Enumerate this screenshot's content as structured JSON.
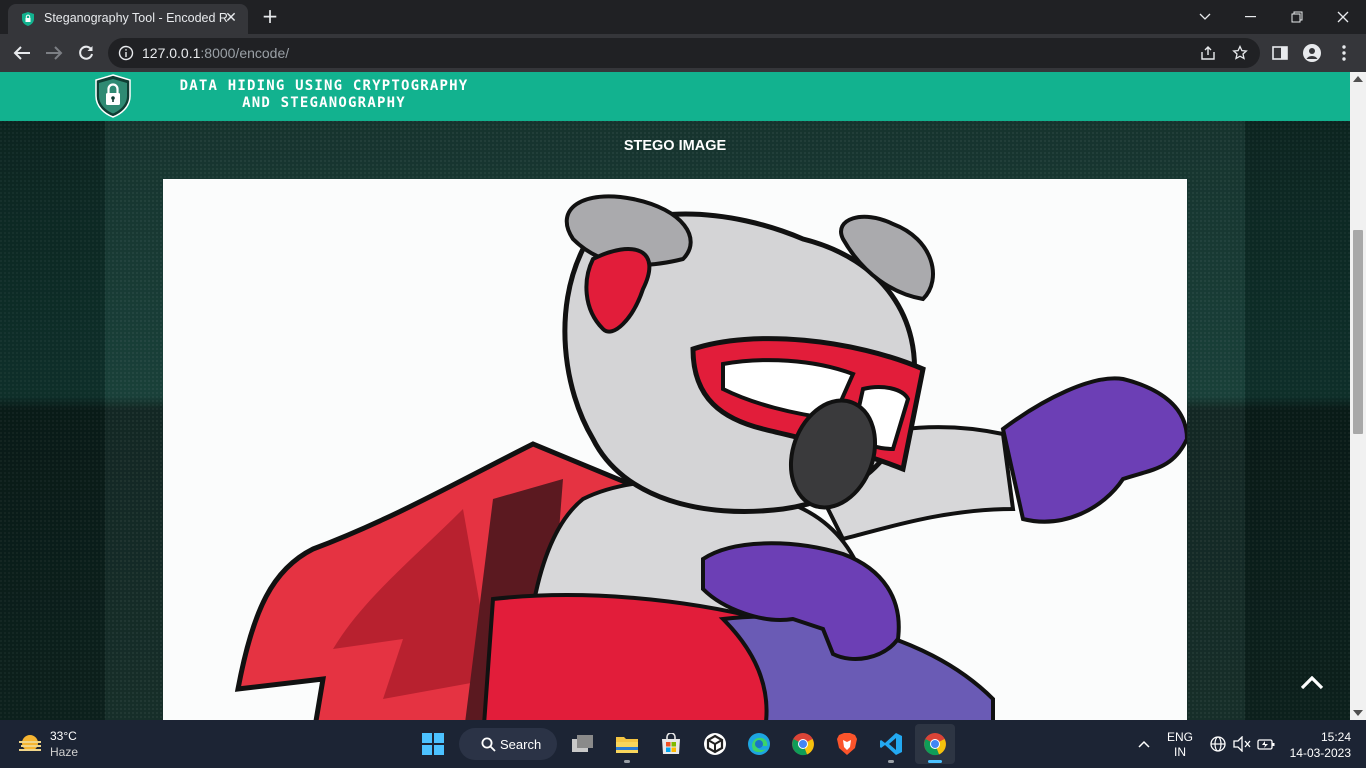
{
  "browser": {
    "tab_title": "Steganography Tool - Encoded Result",
    "url_host": "127.0.0.1",
    "url_path": ":8000/encode/",
    "new_tab_symbol": "+",
    "tab_close_symbol": "✕"
  },
  "site": {
    "brand_line1": "DATA HIDING USING CRYPTOGRAPHY",
    "brand_line2": "AND STEGANOGRAPHY",
    "logo_icon": "shield-lock-icon",
    "header_color": "#12b28f"
  },
  "main": {
    "section_title": "STEGO IMAGE",
    "image_description_icon": "koala-superhero-illustration"
  },
  "taskbar": {
    "weather_temp": "33°C",
    "weather_condition": "Haze",
    "search_label": "Search",
    "lang_line1": "ENG",
    "lang_line2": "IN",
    "time": "15:24",
    "date": "14-03-2023",
    "apps": [
      "start-icon",
      "search",
      "task-view-icon",
      "file-explorer-icon",
      "store-icon",
      "unity-icon",
      "edge-icon",
      "chrome-icon",
      "brave-icon",
      "vscode-icon",
      "chrome-active-icon"
    ]
  }
}
